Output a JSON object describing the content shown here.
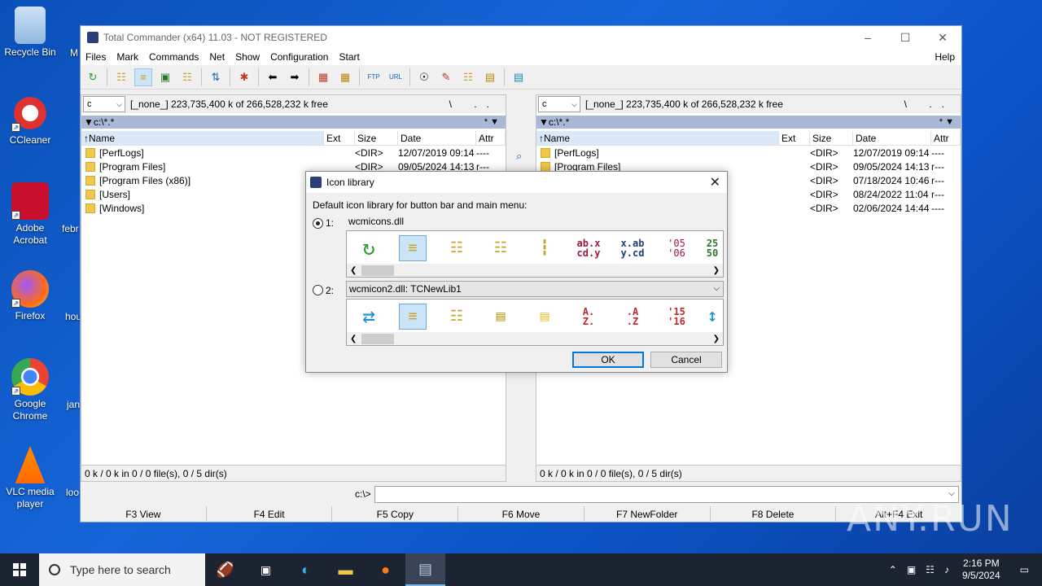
{
  "desktop": {
    "icons": [
      {
        "label": "Recycle Bin"
      },
      {
        "label": "CCleaner"
      },
      {
        "label": "Adobe Acrobat"
      },
      {
        "label": "Firefox"
      },
      {
        "label": "Google Chrome"
      },
      {
        "label": "VLC media player"
      }
    ],
    "peek": [
      "M",
      "febr",
      "hou",
      "jan",
      "loo"
    ]
  },
  "window": {
    "title": "Total Commander (x64) 11.03 - NOT REGISTERED",
    "menu": [
      "Files",
      "Mark",
      "Commands",
      "Net",
      "Show",
      "Configuration",
      "Start"
    ],
    "help": "Help"
  },
  "left_panel": {
    "drive": "c",
    "free": "[_none_]  223,735,400 k of 266,528,232 k free",
    "nav": "\\ ..",
    "path": "c:\\*.*",
    "star": "* ▼",
    "columns": {
      "name": "Name",
      "ext": "Ext",
      "size": "Size",
      "date": "Date",
      "attr": "Attr"
    },
    "files": [
      {
        "name": "[PerfLogs]",
        "size": "<DIR>",
        "date": "12/07/2019 09:14",
        "attr": "----"
      },
      {
        "name": "[Program Files]",
        "size": "<DIR>",
        "date": "09/05/2024 14:13",
        "attr": "r---"
      },
      {
        "name": "[Program Files (x86)]",
        "size": "",
        "date": "",
        "attr": ""
      },
      {
        "name": "[Users]",
        "size": "",
        "date": "",
        "attr": ""
      },
      {
        "name": "[Windows]",
        "size": "",
        "date": "",
        "attr": ""
      }
    ],
    "status": "0 k / 0 k in 0 / 0 file(s), 0 / 5 dir(s)"
  },
  "right_panel": {
    "drive": "c",
    "free": "[_none_]  223,735,400 k of 266,528,232 k free",
    "nav": "\\ ..",
    "path": "c:\\*.*",
    "star": "* ▼",
    "columns": {
      "name": "Name",
      "ext": "Ext",
      "size": "Size",
      "date": "Date",
      "attr": "Attr"
    },
    "files": [
      {
        "name": "[PerfLogs]",
        "size": "<DIR>",
        "date": "12/07/2019 09:14",
        "attr": "----"
      },
      {
        "name": "[Program Files]",
        "size": "<DIR>",
        "date": "09/05/2024 14:13",
        "attr": "r---"
      },
      {
        "name": "",
        "size": "<DIR>",
        "date": "07/18/2024 10:46",
        "attr": "r---"
      },
      {
        "name": "",
        "size": "<DIR>",
        "date": "08/24/2022 11:04",
        "attr": "r---"
      },
      {
        "name": "",
        "size": "<DIR>",
        "date": "02/06/2024 14:44",
        "attr": "----"
      }
    ],
    "status": "0 k / 0 k in 0 / 0 file(s), 0 / 5 dir(s)"
  },
  "cmdline": {
    "path": "c:\\>"
  },
  "fkeys": [
    "F3 View",
    "F4 Edit",
    "F5 Copy",
    "F6 Move",
    "F7 NewFolder",
    "F8 Delete",
    "Alt+F4 Exit"
  ],
  "dialog": {
    "title": "Icon library",
    "description": "Default icon library for button bar and main menu:",
    "option1_label": "1:",
    "option1_lib": "wcmicons.dll",
    "option2_label": "2:",
    "option2_lib": "wcmicon2.dll: TCNewLib1",
    "lib1_icon_text": [
      "ab.x\ncd.y",
      "x.ab\ny.cd",
      "'05\n'06",
      "25\n50"
    ],
    "lib2_icon_text": [
      "A.\nZ.",
      ".A\n.Z",
      "'15\n'16"
    ],
    "ok": "OK",
    "cancel": "Cancel"
  },
  "taskbar": {
    "search_placeholder": "Type here to search",
    "time": "2:16 PM",
    "date": "9/5/2024"
  },
  "watermark": "ANY.RUN"
}
